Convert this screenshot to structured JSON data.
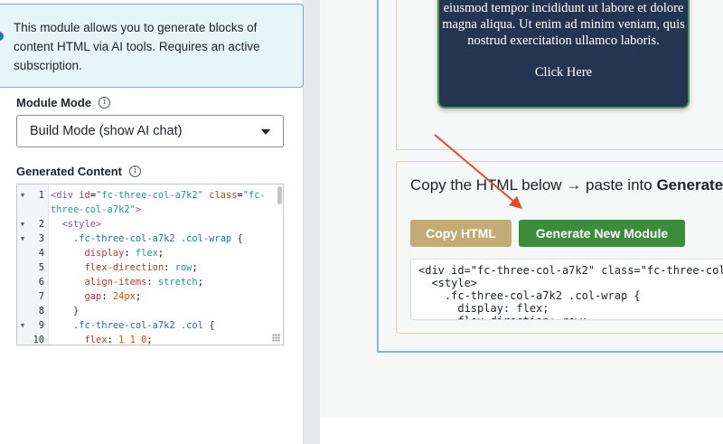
{
  "notice": {
    "text": "This module allows you to generate blocks of content HTML via AI tools. Requires an active subscription."
  },
  "module_mode": {
    "label": "Module Mode",
    "info_icon": "info-icon",
    "selected": "Build Mode (show AI chat)"
  },
  "generated_content": {
    "label": "Generated Content",
    "info_icon": "info-icon",
    "line_numbers": [
      "1",
      "2",
      "3",
      "4",
      "5",
      "6",
      "7",
      "8",
      "9",
      "10"
    ]
  },
  "preview": {
    "hero_text": "eiusmod tempor incididunt ut labore et dolore magna aliqua. Ut enim ad minim veniam, quis nostrud exercitation ullamco laboris.",
    "hero_link": "Click Here",
    "copy_title_prefix": "Copy the HTML below → paste into ",
    "copy_title_bold": "Generated",
    "copy_button": "Copy HTML",
    "generate_button": "Generate New Module",
    "code_text": "<div id=\"fc-three-col-a7k2\" class=\"fc-three-col\n  <style>\n    .fc-three-col-a7k2 .col-wrap {\n      display: flex;\n      flex-direction: row;"
  },
  "colors": {
    "accent_gold": "#c4ab75",
    "accent_green": "#3d8b3d",
    "hero_bg": "#243552",
    "annotation_arrow": "#e04a2f"
  }
}
